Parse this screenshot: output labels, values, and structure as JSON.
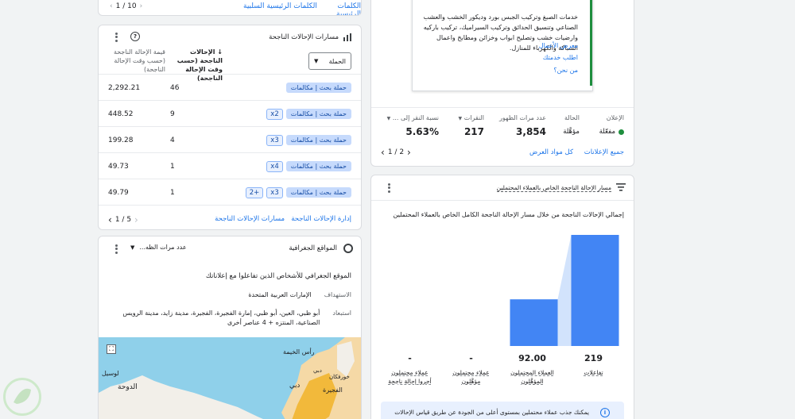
{
  "top_left": {
    "pager": "10 / 1",
    "link1": "الكلمات الرئيسية السلبية",
    "link2": "الكلمات الرئيسية"
  },
  "paths_card": {
    "title": "مسارات الإحالات الناجحة",
    "filter_label": "الحملة",
    "col_conversions": "الإحالات الناجحة (حسب وقت الإحالة الناجحة)",
    "col_value": "قيمة الإحالة الناجحة (حسب وقت الإحالة الناجحة)",
    "campaign_label": "حملة بحث | مكالمات",
    "rows": [
      {
        "badges": [],
        "conversions": "46",
        "value": "2,292.21"
      },
      {
        "badges": [
          "x2"
        ],
        "conversions": "9",
        "value": "448.52"
      },
      {
        "badges": [
          "x3"
        ],
        "conversions": "4",
        "value": "199.28"
      },
      {
        "badges": [
          "x4"
        ],
        "conversions": "1",
        "value": "49.73"
      },
      {
        "badges": [
          "x3",
          "+2"
        ],
        "conversions": "1",
        "value": "49.79"
      }
    ],
    "footer_link1": "إدارة الإحالات الناجحة",
    "footer_link2": "مسارات الإحالات الناجحة",
    "pager": "5 / 1"
  },
  "geo_card": {
    "title": "المواقع الجغرافية",
    "dropdown": "عدد مرات الظه...",
    "heading": "الموقع الجغرافي للأشخاص الذين تفاعلوا مع إعلاناتك",
    "target_label": "الاستهداف",
    "target_value": "الإمارات العربية المتحدة",
    "exclude_label": "استبعاد",
    "exclude_value": "أبو ظبي، العين، أبو ظبي، إمارة الفجيرة، الفجيرة، مدينة زايد، مدينة الرويس الصناعية، المنتزه + 4 عناصر أخرى",
    "map_labels": {
      "ras": "رأس الخيمة",
      "dubai": "دبي",
      "doha": "الدوحة",
      "fujairah": "الفجيرة",
      "khor": "خورفكان",
      "dubai2": "دبي",
      "usel": "لوسيل"
    }
  },
  "ad_card": {
    "ad_text": "خدمات الصبغ وتركيب الجبس بورد وديكور الخشب والعشب الصناعي وتنسيق الحدائق وتركيب السيراميك، تركيب باركيه وارضيات خشب وتصليح ابواب وخزائن ومطابخ واعمال السباكة والكهرباء للمنازل.",
    "link1": "معرض الأعمال",
    "link2": "اطلب خدمتك",
    "link3": "من نحن؟",
    "labels": {
      "ad": "الإعلان",
      "status": "الحالة",
      "impressions": "عدد مرات الظهور",
      "clicks": "النقرات",
      "ctr": "نسبة النقر إلى ..."
    },
    "values": {
      "ad": "مفعّلة",
      "status": "مؤهَّلة",
      "impressions": "3,854",
      "clicks": "217",
      "ctr": "5.63%"
    },
    "footer_link1": "جميع الإعلانات",
    "footer_link2": "كل مواد العرض",
    "pager": "2 / 1"
  },
  "funnel_card": {
    "title": "مسار الإحالة الناجحة الخاص بالعملاء المحتملين",
    "chart_title": "إجمالي الإحالات الناجحة من خلال مسار الإحالة الناجحة الكامل الخاص بالعملاء المحتملين",
    "banner": "يمكنك جذب عملاء محتملين بمستوى أعلى من الجودة عن طريق قياس الإحالات"
  },
  "chart_data": {
    "type": "bar",
    "categories": [
      "تفاعلات",
      "العملاء المحتملون المؤهَّلون",
      "عملاء محتملون مؤهَّلون",
      "عملاء محتملون أجروا إحالة ناجحة"
    ],
    "values": [
      219,
      92,
      null,
      null
    ],
    "labels": [
      "219",
      "92.00",
      "-",
      "-"
    ],
    "colors": {
      "bar": "#4285f4",
      "connector": "#d2e3fc"
    }
  }
}
